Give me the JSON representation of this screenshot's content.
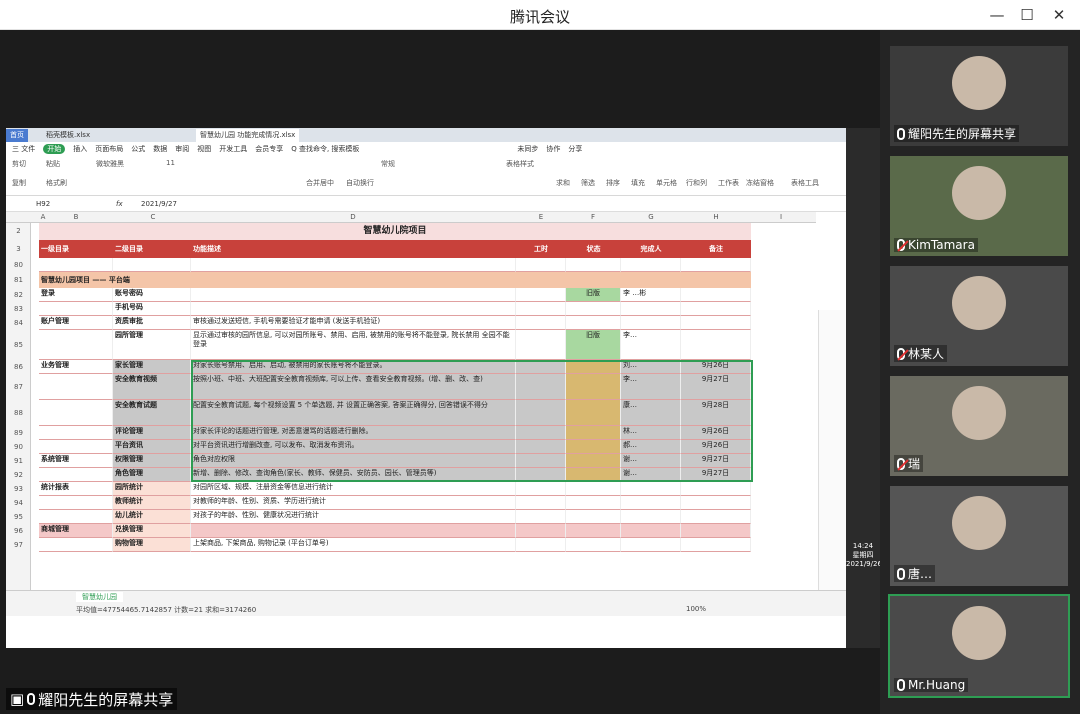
{
  "window": {
    "title": "腾讯会议"
  },
  "share": {
    "banner": "耀阳先生的屏幕共享"
  },
  "wps": {
    "tabs": [
      "首页",
      "稻壳模板.xlsx",
      "智慧幼儿园 功能完成情况.xlsx"
    ],
    "menu": [
      "三 文件",
      "开始",
      "插入",
      "页面布局",
      "公式",
      "数据",
      "审阅",
      "视图",
      "开发工具",
      "会员专享",
      "Q 查找命令, 搜索模板",
      "未同步",
      "协作",
      "分享"
    ],
    "ribbon": [
      "剪切",
      "粘贴",
      "复制",
      "格式刷",
      "微软雅黑",
      "11",
      "合并居中",
      "自动换行",
      "常规",
      "表格样式",
      "求和",
      "筛选",
      "排序",
      "填充",
      "单元格",
      "行和列",
      "工作表",
      "冻结窗格",
      "表格工具"
    ],
    "formula": {
      "cell": "H92",
      "fx": "fx",
      "value": "2021/9/27"
    },
    "cols": [
      "A",
      "B",
      "C",
      "D",
      "E",
      "F",
      "G",
      "H",
      "I"
    ],
    "title": "智慧幼儿院项目",
    "header": {
      "a": "一级目录",
      "b": "二级目录",
      "c": "功能描述",
      "d": "工时",
      "e": "状态",
      "f": "完成人",
      "g": "备注"
    },
    "rows": [
      {
        "n": "2"
      },
      {
        "n": "3"
      },
      {
        "n": "80"
      },
      {
        "n": "81",
        "a": "智慧幼儿园项目 —— 平台端"
      },
      {
        "n": "82",
        "a": "登录",
        "b": "账号密码",
        "e": "旧版",
        "f": "李 …彬"
      },
      {
        "n": "83",
        "b": "手机号码"
      },
      {
        "n": "84",
        "a": "账户管理",
        "b": "资质审批",
        "c": "审核通过发送短信, 手机号需要验证才能申请 (发送手机验证)"
      },
      {
        "n": "85",
        "b": "园所管理",
        "c": "显示通过审核的园所信息, 可以对园所账号、禁用、启用, 被禁用的账号将不能登录, 院长禁用 全园不能登录",
        "e": "旧版",
        "f": "李…"
      },
      {
        "n": "86",
        "a": "业务管理",
        "b": "家长管理",
        "c": "对家长账号禁用、启用、启动, 被禁用的家长账号将不能登录。",
        "f": "刘…",
        "g": "9月26日"
      },
      {
        "n": "87",
        "b": "安全教育视频",
        "c": "按照小班、中班、大班配置安全教育视频库, 可以上传、查看安全教育视频。(增、删、改、查)",
        "f": "李…",
        "g": "9月27日"
      },
      {
        "n": "88",
        "b": "安全教育试题",
        "c": "配置安全教育试题, 每个视频设置 5 个单选题, 并 设置正确答案, 答案正确得分, 回答错误不得分",
        "f": "康…",
        "g": "9月28日"
      },
      {
        "n": "89",
        "b": "评论管理",
        "c": "对家长评论的话题进行管理, 对恶意谩骂的话题进行删除。",
        "f": "林…",
        "g": "9月26日"
      },
      {
        "n": "90",
        "b": "平台资讯",
        "c": "对平台资讯进行增删改查, 可以发布、取消发布资讯。",
        "f": "郝…",
        "g": "9月26日"
      },
      {
        "n": "91",
        "a": "系统管理",
        "b": "权限管理",
        "c": "角色对应权限",
        "f": "谢…",
        "g": "9月27日"
      },
      {
        "n": "92",
        "b": "角色管理",
        "c": "新增、删除、修改、查询角色(家长、教师、保健员、安防员、园长、管理员等)",
        "f": "谢…",
        "g": "9月27日"
      },
      {
        "n": "93",
        "a": "统计报表",
        "b": "园所统计",
        "c": "对园所区域、规模、注册资金等信息进行统计"
      },
      {
        "n": "94",
        "b": "教师统计",
        "c": "对教师的年龄、性别、资质、学历进行统计"
      },
      {
        "n": "95",
        "b": "幼儿统计",
        "c": "对孩子的年龄、性别、健康状况进行统计"
      },
      {
        "n": "96",
        "a": "商城管理",
        "b": "兑换管理"
      },
      {
        "n": "97",
        "b": "购物管理",
        "c": "上架商品, 下架商品, 购物记录 (平台订单号)"
      }
    ],
    "sheet": "智慧幼儿园",
    "status": "平均值=47754465.7142857 计数=21 求和=3174260",
    "zoom": "100%",
    "clock": {
      "time": "14:24",
      "day": "星期四",
      "date": "2021/9/26"
    }
  },
  "participants": [
    {
      "name": "耀阳先生的屏幕共享",
      "mic": "on"
    },
    {
      "name": "KimTamara",
      "mic": "off"
    },
    {
      "name": "林某人",
      "mic": "off"
    },
    {
      "name": "瑞",
      "mic": "off"
    },
    {
      "name": "唐…",
      "mic": "on"
    },
    {
      "name": "Mr.Huang",
      "mic": "on"
    }
  ],
  "colors": {
    "title_red": "#c0392b",
    "header_red": "#c8413b",
    "row_peach": "#f4c5a8",
    "status_green": "#a8d8a0",
    "meeting_bg": "#1c1c1c",
    "highlight": "#c8c8c8"
  }
}
